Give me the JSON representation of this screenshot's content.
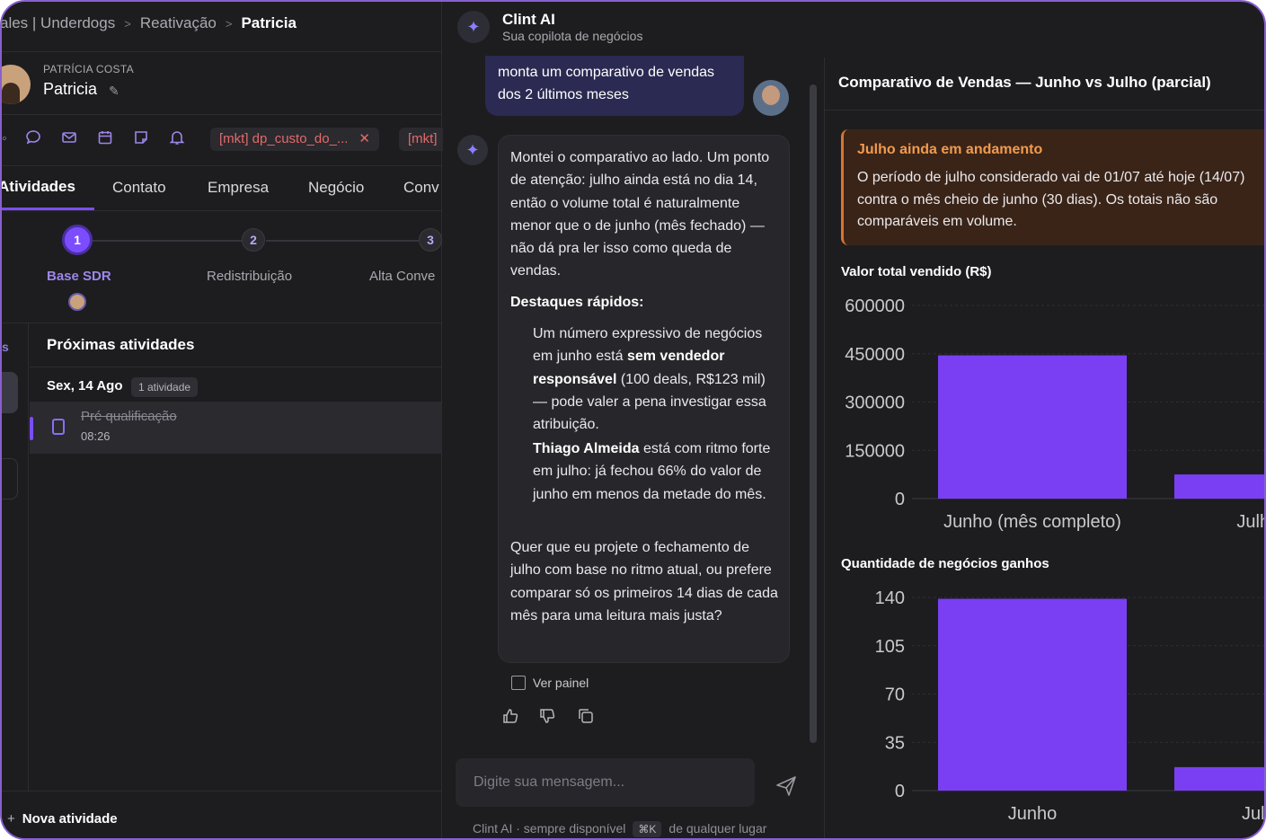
{
  "breadcrumb": {
    "part1": "ales | Underdogs",
    "part2": "Reativação",
    "current": "Patricia"
  },
  "contact": {
    "supertitle": "PATRÍCIA COSTA",
    "name": "Patricia"
  },
  "tags": [
    {
      "label": "[mkt] dp_custo_do_..."
    },
    {
      "label": "[mkt]"
    }
  ],
  "tabs": [
    "Atividades",
    "Contato",
    "Empresa",
    "Negócio",
    "Conv"
  ],
  "pipeline": {
    "steps": [
      {
        "number": "1",
        "label": "Base SDR"
      },
      {
        "number": "2",
        "label": "Redistribuição"
      },
      {
        "number": "3",
        "label": "Alta Conve"
      }
    ]
  },
  "activities": {
    "strip_letter": "s",
    "title": "Próximas atividades",
    "day": "Sex, 14 Ago",
    "day_count": "1 atividade",
    "items": [
      {
        "title": "Pré qualificação",
        "time": "08:26"
      }
    ],
    "new_label": "Nova atividade"
  },
  "chat": {
    "title": "Clint AI",
    "subtitle": "Sua copilota de negócios",
    "user_message": "monta um comparativo de vendas dos 2 últimos meses",
    "ai_paragraph1": "Montei o comparativo ao lado. Um ponto de atenção: julho ainda está no dia 14, então o volume total é naturalmente menor que o de junho (mês fechado) — não dá pra ler isso como queda de vendas.",
    "ai_highlights_title": "Destaques rápidos:",
    "ai_bullet1_pre": "Um número expressivo de negócios em junho está ",
    "ai_bullet1_bold": "sem vendedor responsável",
    "ai_bullet1_post": " (100 deals, R$123 mil) — pode valer a pena investigar essa atribuição.",
    "ai_bullet2_bold": "Thiago Almeida",
    "ai_bullet2_post": " está com ritmo forte em julho: já fechou 66% do valor de junho em menos da metade do mês.",
    "ai_paragraph2": "Quer que eu projete o fechamento de julho com base no ritmo atual, ou prefere comparar só os primeiros 14 dias de cada mês para uma leitura mais justa?",
    "view_panel": "Ver painel",
    "input_placeholder": "Digite sua mensagem...",
    "footer_pre": "Clint AI · sempre disponível",
    "footer_kbd": "⌘K",
    "footer_post": "de qualquer lugar"
  },
  "panel": {
    "title": "Comparativo de Vendas — Junho vs Julho (parcial)",
    "alert_title": "Julho ainda em andamento",
    "alert_body": "O período de julho considerado vai de 01/07 até hoje (14/07) contra o mês cheio de junho (30 dias). Os totais não são comparáveis em volume."
  },
  "colors": {
    "accent": "#7c4dff",
    "bar": "#7a3ff2",
    "alert_border": "#d9742c"
  },
  "icons": [
    "chat-icon",
    "mail-icon",
    "calendar-icon",
    "note-icon",
    "bell-icon",
    "sparkle-icon",
    "send-icon",
    "thumbs-up-icon",
    "thumbs-down-icon",
    "copy-icon",
    "panel-icon",
    "edit-icon",
    "clipboard-icon"
  ],
  "chart_data": [
    {
      "type": "bar",
      "title": "Valor total vendido (R$)",
      "categories": [
        "Junho (mês completo)",
        "Julho (a"
      ],
      "values": [
        445000,
        75000
      ],
      "yticks": [
        "600000",
        "450000",
        "300000",
        "150000",
        "0"
      ],
      "ylim": [
        0,
        600000
      ]
    },
    {
      "type": "bar",
      "title": "Quantidade de negócios ganhos",
      "categories": [
        "Junho",
        "Julho ("
      ],
      "values": [
        139,
        17
      ],
      "yticks": [
        "140",
        "105",
        "70",
        "35",
        "0"
      ],
      "ylim": [
        0,
        140
      ]
    }
  ]
}
